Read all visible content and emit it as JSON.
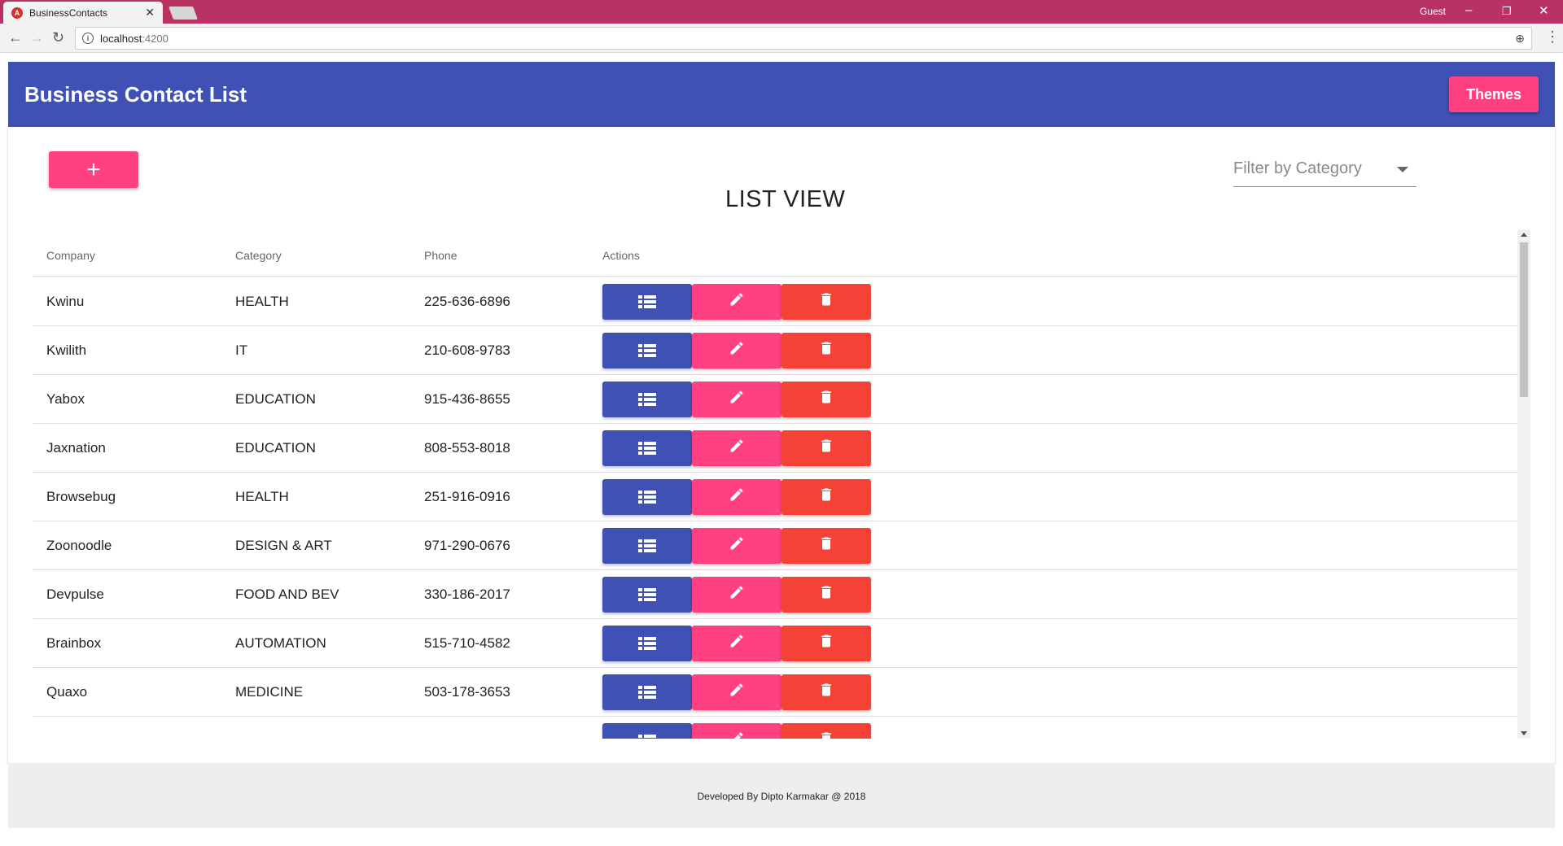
{
  "browser": {
    "tab_title": "BusinessContacts",
    "favicon_letter": "A",
    "user": "Guest",
    "url_host": "localhost",
    "url_port": ":4200"
  },
  "app": {
    "title": "Business Contact List",
    "themes_label": "Themes",
    "add_label": "+",
    "filter_placeholder": "Filter by Category",
    "list_title": "LIST VIEW"
  },
  "table": {
    "headers": {
      "company": "Company",
      "category": "Category",
      "phone": "Phone",
      "actions": "Actions"
    },
    "rows": [
      {
        "company": "Kwinu",
        "category": "HEALTH",
        "phone": "225-636-6896"
      },
      {
        "company": "Kwilith",
        "category": "IT",
        "phone": "210-608-9783"
      },
      {
        "company": "Yabox",
        "category": "EDUCATION",
        "phone": "915-436-8655"
      },
      {
        "company": "Jaxnation",
        "category": "EDUCATION",
        "phone": "808-553-8018"
      },
      {
        "company": "Browsebug",
        "category": "HEALTH",
        "phone": "251-916-0916"
      },
      {
        "company": "Zoonoodle",
        "category": "DESIGN & ART",
        "phone": "971-290-0676"
      },
      {
        "company": "Devpulse",
        "category": "FOOD AND BEV",
        "phone": "330-186-2017"
      },
      {
        "company": "Brainbox",
        "category": "AUTOMATION",
        "phone": "515-710-4582"
      },
      {
        "company": "Quaxo",
        "category": "MEDICINE",
        "phone": "503-178-3653"
      },
      {
        "company": "",
        "category": "",
        "phone": ""
      }
    ]
  },
  "footer": {
    "text": "Developed By Dipto Karmakar @ 2018"
  },
  "colors": {
    "primary": "#3f51b5",
    "accent": "#ff4081",
    "warn": "#f44336",
    "chrome": "#b83363"
  },
  "icons": {
    "view": "list-icon",
    "edit": "pencil-icon",
    "delete": "trash-icon"
  }
}
